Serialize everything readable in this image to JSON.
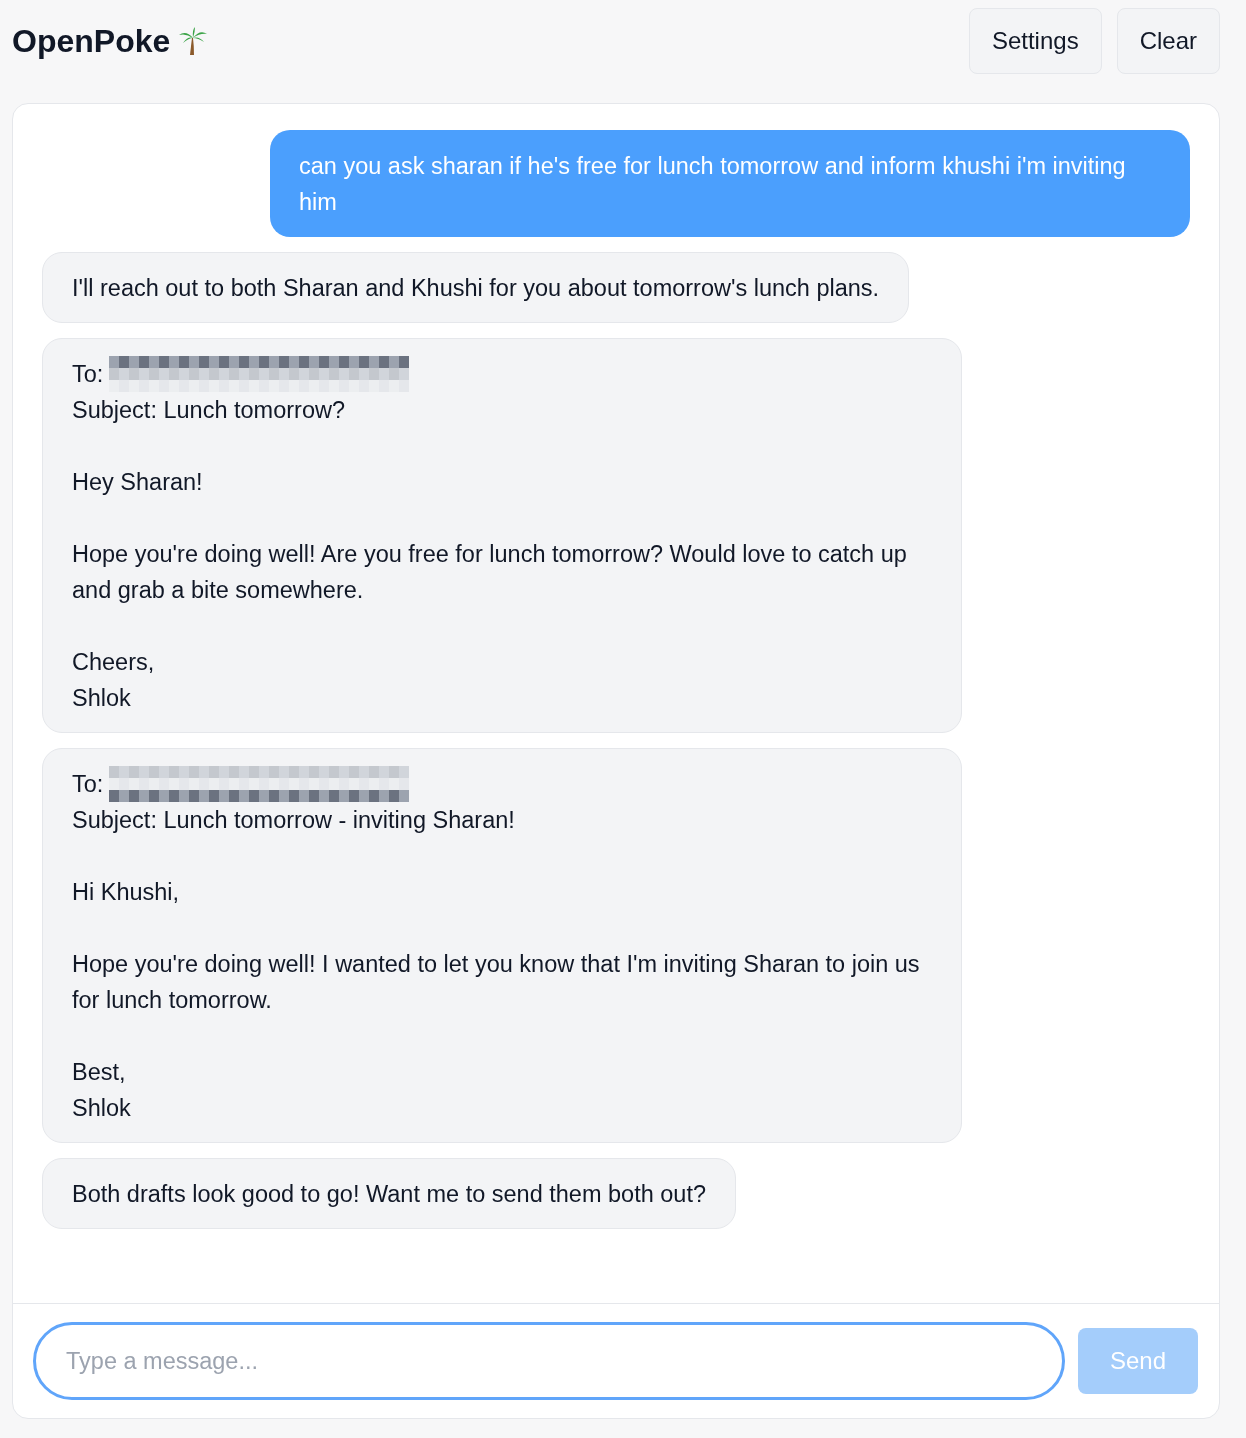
{
  "header": {
    "title": "OpenPoke",
    "buttons": [
      {
        "label": "Settings"
      },
      {
        "label": "Clear"
      }
    ]
  },
  "messages": [
    {
      "kind": "user",
      "text": "can you ask sharan if he's free for lunch tomorrow and inform khushi i'm inviting him"
    },
    {
      "kind": "assistant",
      "text": "I'll reach out to both Sharan and Khushi for you about tomorrow's lunch plans."
    },
    {
      "kind": "draft",
      "to_label": "To:",
      "text": "Subject: Lunch tomorrow?\n\nHey Sharan!\n\nHope you're doing well! Are you free for lunch tomorrow? Would love to catch up and grab a bite somewhere.\n\nCheers,\nShlok"
    },
    {
      "kind": "draft",
      "to_label": "To:",
      "text": "Subject: Lunch tomorrow - inviting Sharan!\n\nHi Khushi,\n\nHope you're doing well! I wanted to let you know that I'm inviting Sharan to join us for lunch tomorrow.\n\nBest,\nShlok"
    },
    {
      "kind": "assistant",
      "text": "Both drafts look good to go! Want me to send them both out?"
    }
  ],
  "composer": {
    "placeholder": "Type a message...",
    "send": {
      "label": "Send",
      "disabled": true
    }
  }
}
